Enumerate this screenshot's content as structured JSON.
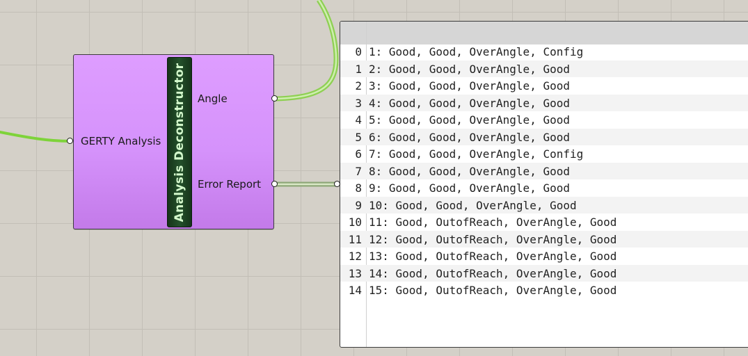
{
  "component": {
    "title": "Analysis Deconstructor",
    "input": "GERTY Analysis",
    "outputs": {
      "angle": "Angle",
      "error": "Error Report"
    }
  },
  "panel": {
    "rows": [
      {
        "index": "0",
        "text": "1: Good, Good, OverAngle, Config"
      },
      {
        "index": "1",
        "text": "2: Good, Good, OverAngle, Good"
      },
      {
        "index": "2",
        "text": "3: Good, Good, OverAngle, Good"
      },
      {
        "index": "3",
        "text": "4: Good, Good, OverAngle, Good"
      },
      {
        "index": "4",
        "text": "5: Good, Good, OverAngle, Good"
      },
      {
        "index": "5",
        "text": "6: Good, Good, OverAngle, Good"
      },
      {
        "index": "6",
        "text": "7: Good, Good, OverAngle, Config"
      },
      {
        "index": "7",
        "text": "8: Good, Good, OverAngle, Good"
      },
      {
        "index": "8",
        "text": "9: Good, Good, OverAngle, Good"
      },
      {
        "index": "9",
        "text": "10: Good, Good, OverAngle, Good"
      },
      {
        "index": "10",
        "text": "11: Good, OutofReach, OverAngle, Good"
      },
      {
        "index": "11",
        "text": "12: Good, OutofReach, OverAngle, Good"
      },
      {
        "index": "12",
        "text": "13: Good, OutofReach, OverAngle, Good"
      },
      {
        "index": "13",
        "text": "14: Good, OutofReach, OverAngle, Good"
      },
      {
        "index": "14",
        "text": "15: Good, OutofReach, OverAngle, Good"
      }
    ]
  },
  "colors": {
    "canvas": "#d4d0c8",
    "component": "#d592fb",
    "title_bar": "#23502a",
    "title_text": "#d4f9cc",
    "wire": "#7ed33a"
  }
}
